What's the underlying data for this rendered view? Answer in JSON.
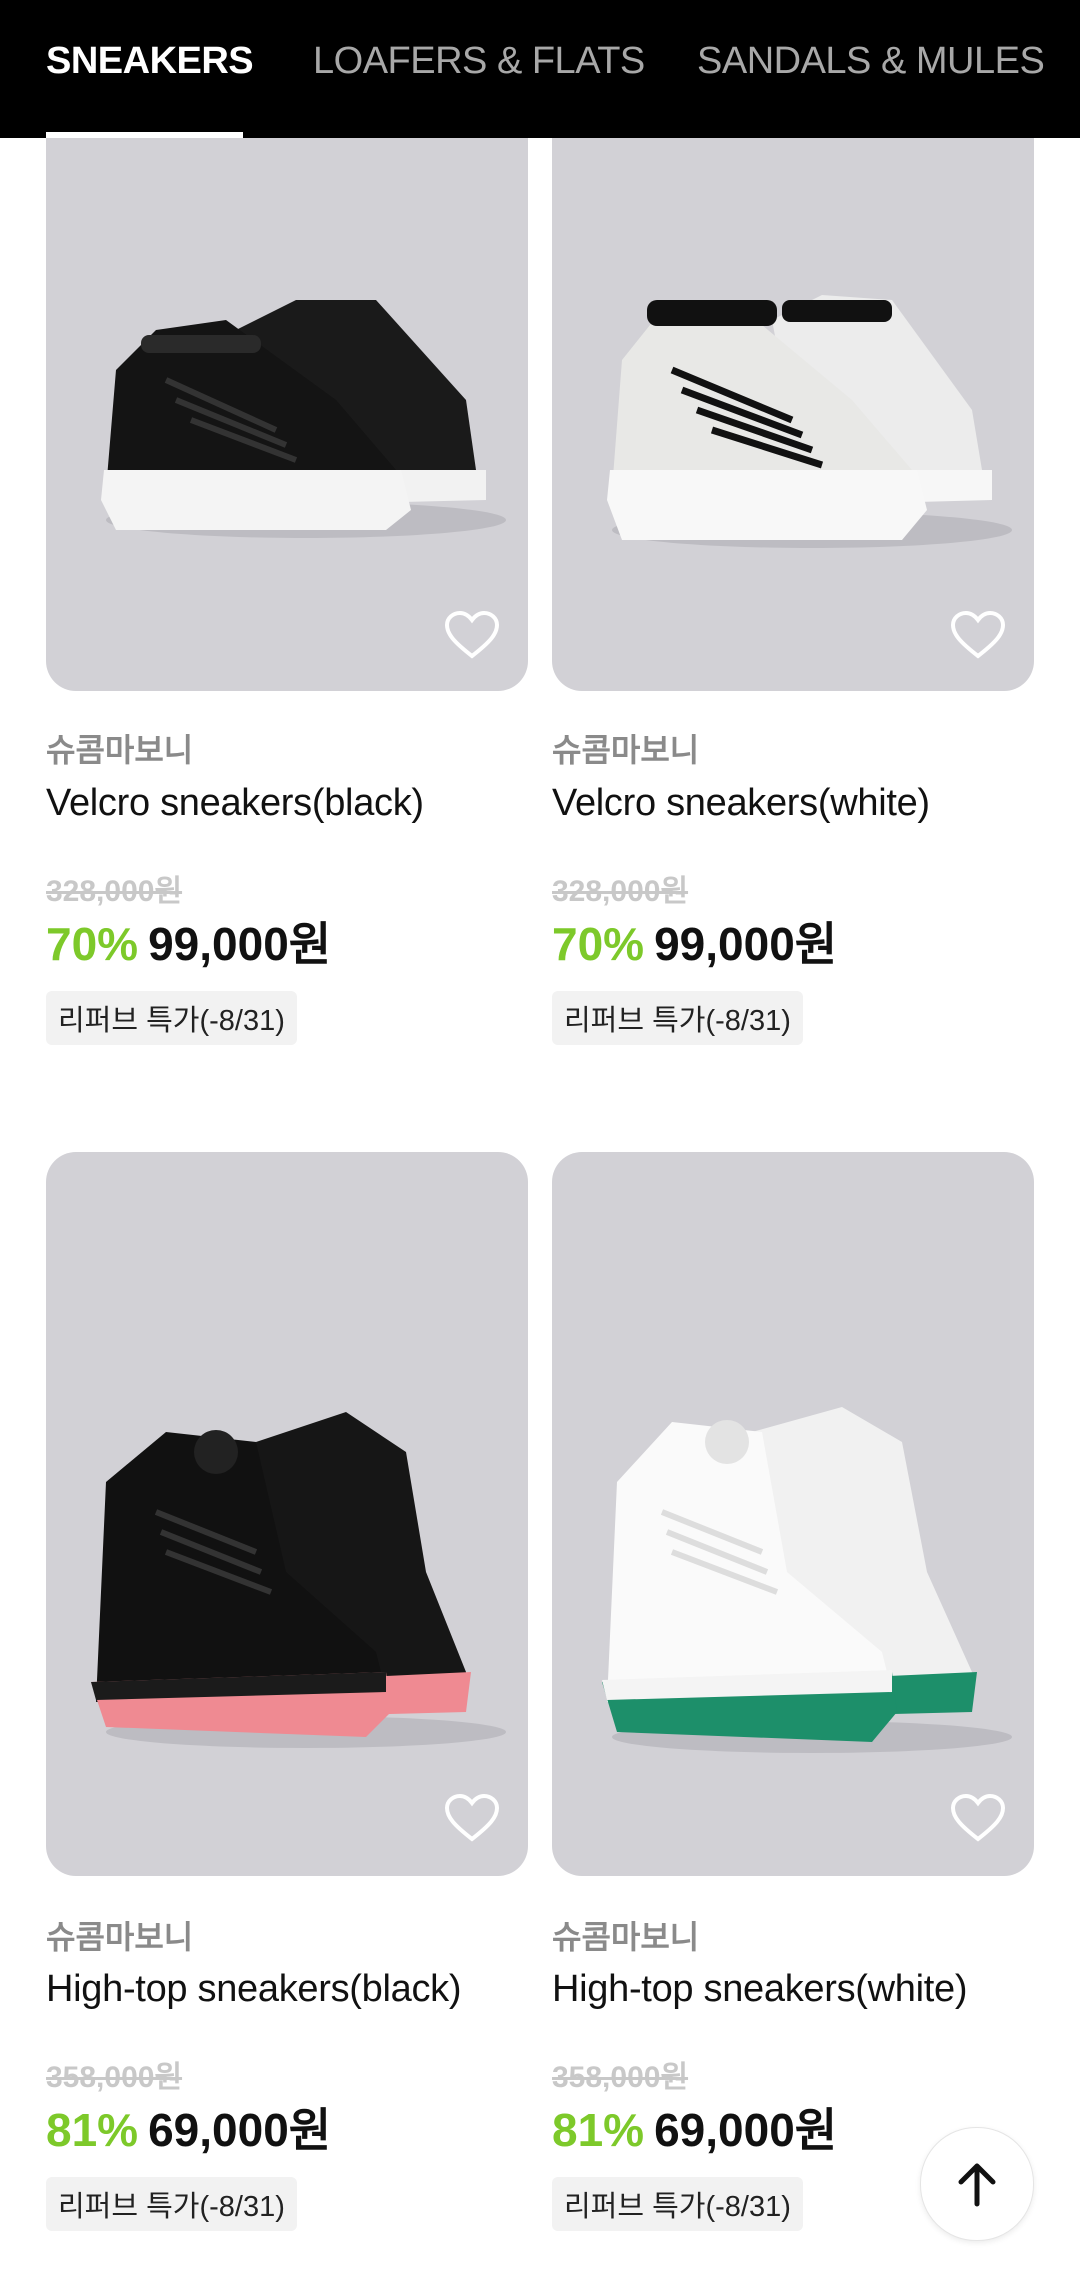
{
  "tabs": [
    {
      "label": "SNEAKERS",
      "active": true
    },
    {
      "label": "LOAFERS & FLATS",
      "active": false
    },
    {
      "label": "SANDALS & MULES",
      "active": false
    }
  ],
  "products": [
    {
      "brand": "슈콤마보니",
      "name": "Velcro sneakers(black)",
      "original_price": "328,000원",
      "discount": "70%",
      "price": "99,000원",
      "badge": "리퍼브 특가(-8/31)",
      "image": "black-velcro-sneakers"
    },
    {
      "brand": "슈콤마보니",
      "name": "Velcro sneakers(white)",
      "original_price": "328,000원",
      "discount": "70%",
      "price": "99,000원",
      "badge": "리퍼브 특가(-8/31)",
      "image": "white-velcro-sneakers"
    },
    {
      "brand": "슈콤마보니",
      "name": "High-top sneakers(black)",
      "original_price": "358,000원",
      "discount": "81%",
      "price": "69,000원",
      "badge": "리퍼브 특가(-8/31)",
      "image": "black-hightop-sneakers-pink-sole"
    },
    {
      "brand": "슈콤마보니",
      "name": "High-top sneakers(white)",
      "original_price": "358,000원",
      "discount": "81%",
      "price": "69,000원",
      "badge": "리퍼브 특가(-8/31)",
      "image": "white-hightop-sneakers-green-sole"
    }
  ],
  "icons": {
    "wishlist": "heart-outline-icon",
    "scroll_top": "arrow-up-icon"
  },
  "colors": {
    "discount": "#7dc92a",
    "tab_bar": "#000000",
    "photo_bg": "#d2d1d6"
  }
}
